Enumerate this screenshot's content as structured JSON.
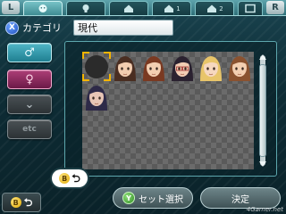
{
  "top_bar": {
    "shoulder_left": "L",
    "shoulder_right": "R",
    "tabs": [
      {
        "icon": "face-icon",
        "label": "",
        "active": true
      },
      {
        "icon": "bulb-icon",
        "label": "",
        "active": false
      },
      {
        "icon": "home-icon",
        "label": "",
        "active": false
      },
      {
        "icon": "home-icon",
        "label": "1",
        "active": false
      },
      {
        "icon": "home-icon",
        "label": "2",
        "active": false
      }
    ],
    "extra_icon": "window-icon"
  },
  "category": {
    "button": "X",
    "label": "カテゴリ",
    "value": "現代"
  },
  "filters": {
    "male": "♂",
    "female": "♀",
    "other": "⌄",
    "etc": "etc"
  },
  "portraits": [
    {
      "kind": "empty-slot",
      "selected": true
    },
    {
      "kind": "character",
      "hair": "#4a2e22",
      "skin": "#f2cdb0"
    },
    {
      "kind": "character",
      "hair": "#7a3a22",
      "skin": "#f3cfb2"
    },
    {
      "kind": "character",
      "hair": "#2b2230",
      "skin": "#f2cdb4",
      "glasses": true
    },
    {
      "kind": "character",
      "hair": "#e8c56a",
      "skin": "#f6d8bf"
    },
    {
      "kind": "character",
      "hair": "#8a5230",
      "skin": "#f3cfb2"
    },
    {
      "kind": "character",
      "hair": "#2e2a48",
      "skin": "#e8c6b6"
    }
  ],
  "buttons": {
    "b_label": "B",
    "back_glyph": "⮌",
    "y_label": "Y",
    "set_select": "セット選択",
    "confirm": "決定"
  },
  "watermark": "4Gamer.net",
  "colors": {
    "accent": "#5ea3ab",
    "female": "#ad3f77",
    "male": "#4fb6c7",
    "cursor": "#f4b400"
  }
}
